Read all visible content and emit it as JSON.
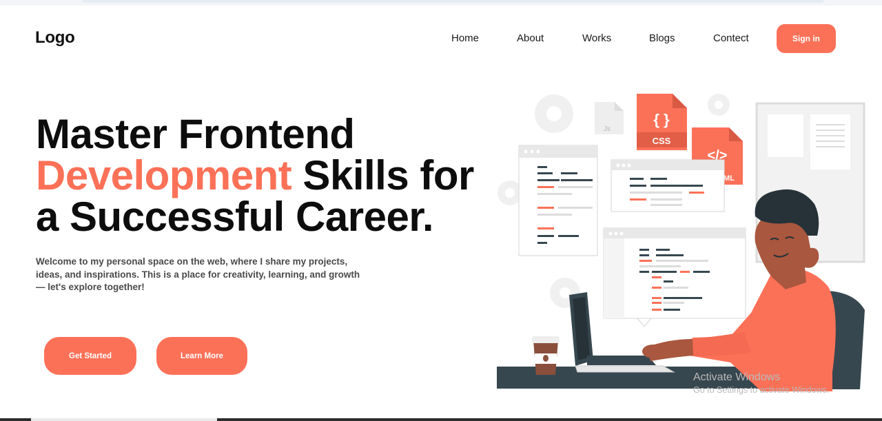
{
  "header": {
    "logo": "Logo",
    "nav": [
      "Home",
      "About",
      "Works",
      "Blogs",
      "Contect"
    ],
    "signin_label": "Sign in"
  },
  "hero": {
    "line1": "Master Frontend",
    "line2_accent": "Development",
    "line2_rest": " Skills for",
    "line3": "a Successful Career.",
    "intro": "Welcome to my personal space on the web, where I share my projects, ideas, and inspirations. This is a place for creativity, learning, and growth — let's explore together!",
    "get_started_label": "Get Started",
    "learn_more_label": "Learn More"
  },
  "illustration": {
    "css_file_label": "CSS",
    "html_file_label": "</>",
    "html_file_text": "ML",
    "js_file_label": "Js",
    "css_braces": "{ }"
  },
  "colors": {
    "accent": "#fb7158",
    "dark": "#0d0d0d",
    "slate": "#37474f"
  },
  "os_overlay": {
    "activate_title": "Activate Windows",
    "activate_subtitle": "Go to Settings to activate Windows."
  }
}
